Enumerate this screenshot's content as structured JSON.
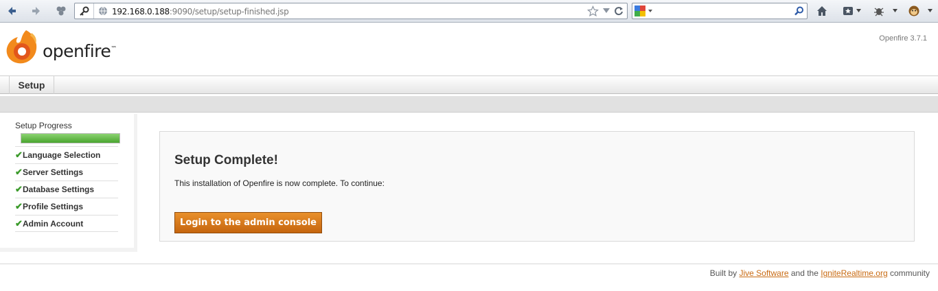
{
  "browser": {
    "url_host": "192.168.0.188",
    "url_rest": ":9090/setup/setup-finished.jsp",
    "search_placeholder": ""
  },
  "header": {
    "logo_text": "openfire",
    "trademark": "™",
    "version": "Openfire 3.7.1"
  },
  "tabs": {
    "setup_label": "Setup"
  },
  "sidebar": {
    "title": "Setup Progress",
    "progress_fraction": 1.0,
    "items": [
      {
        "label": "Language Selection"
      },
      {
        "label": "Server Settings"
      },
      {
        "label": "Database Settings"
      },
      {
        "label": "Profile Settings"
      },
      {
        "label": "Admin Account"
      }
    ]
  },
  "content": {
    "heading": "Setup Complete!",
    "message": "This installation of Openfire is now complete. To continue:",
    "login_button": "Login to the admin console"
  },
  "footer": {
    "built_by": "Built by",
    "jive_link": "Jive Software",
    "and_the": "and the",
    "ignite_link": "IgniteRealtime.org",
    "community": "community"
  },
  "colors": {
    "accent_orange": "#d97a1a",
    "progress_green": "#5cb83d",
    "check_green": "#3b9a2a"
  }
}
